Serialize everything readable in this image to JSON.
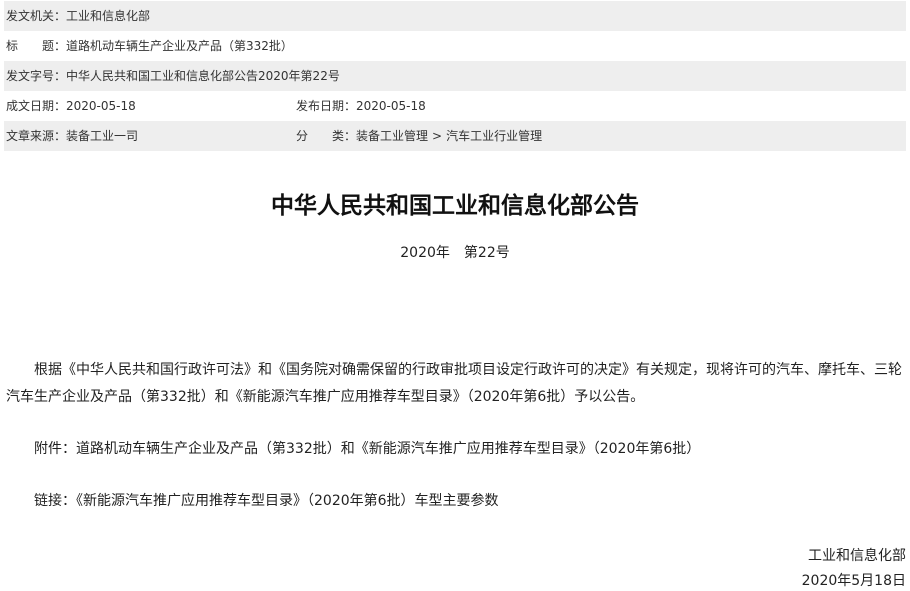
{
  "meta": {
    "issuer_label": "发文机关：",
    "issuer_value": "工业和信息化部",
    "title_label_a": "标",
    "title_label_b": "题：",
    "title_value": "道路机动车辆生产企业及产品（第332批）",
    "docno_label": "发文字号：",
    "docno_value": "中华人民共和国工业和信息化部公告2020年第22号",
    "created_label": "成文日期：",
    "created_value": "2020-05-18",
    "published_label": "发布日期：",
    "published_value": "2020-05-18",
    "source_label": "文章来源：",
    "source_value": "装备工业一司",
    "category_label_a": "分",
    "category_label_b": "类：",
    "category_1": "装备工业管理",
    "category_sep": ">",
    "category_2": "汽车工业行业管理"
  },
  "article": {
    "heading": "中华人民共和国工业和信息化部公告",
    "year": "2020年",
    "number": "第22号",
    "paragraph_1": "根据《中华人民共和国行政许可法》和《国务院对确需保留的行政审批项目设定行政许可的决定》有关规定，现将许可的汽车、摩托车、三轮汽车生产企业及产品（第332批）和《新能源汽车推广应用推荐车型目录》（2020年第6批）予以公告。",
    "attachment_label": "附件：",
    "attachment_link": "道路机动车辆生产企业及产品（第332批）和《新能源汽车推广应用推荐车型目录》（2020年第6批）",
    "link_label": "链接：",
    "link_text": "《新能源汽车推广应用推荐车型目录》（2020年第6批）车型主要参数",
    "signature_org": "工业和信息化部",
    "signature_date": "2020年5月18日"
  }
}
